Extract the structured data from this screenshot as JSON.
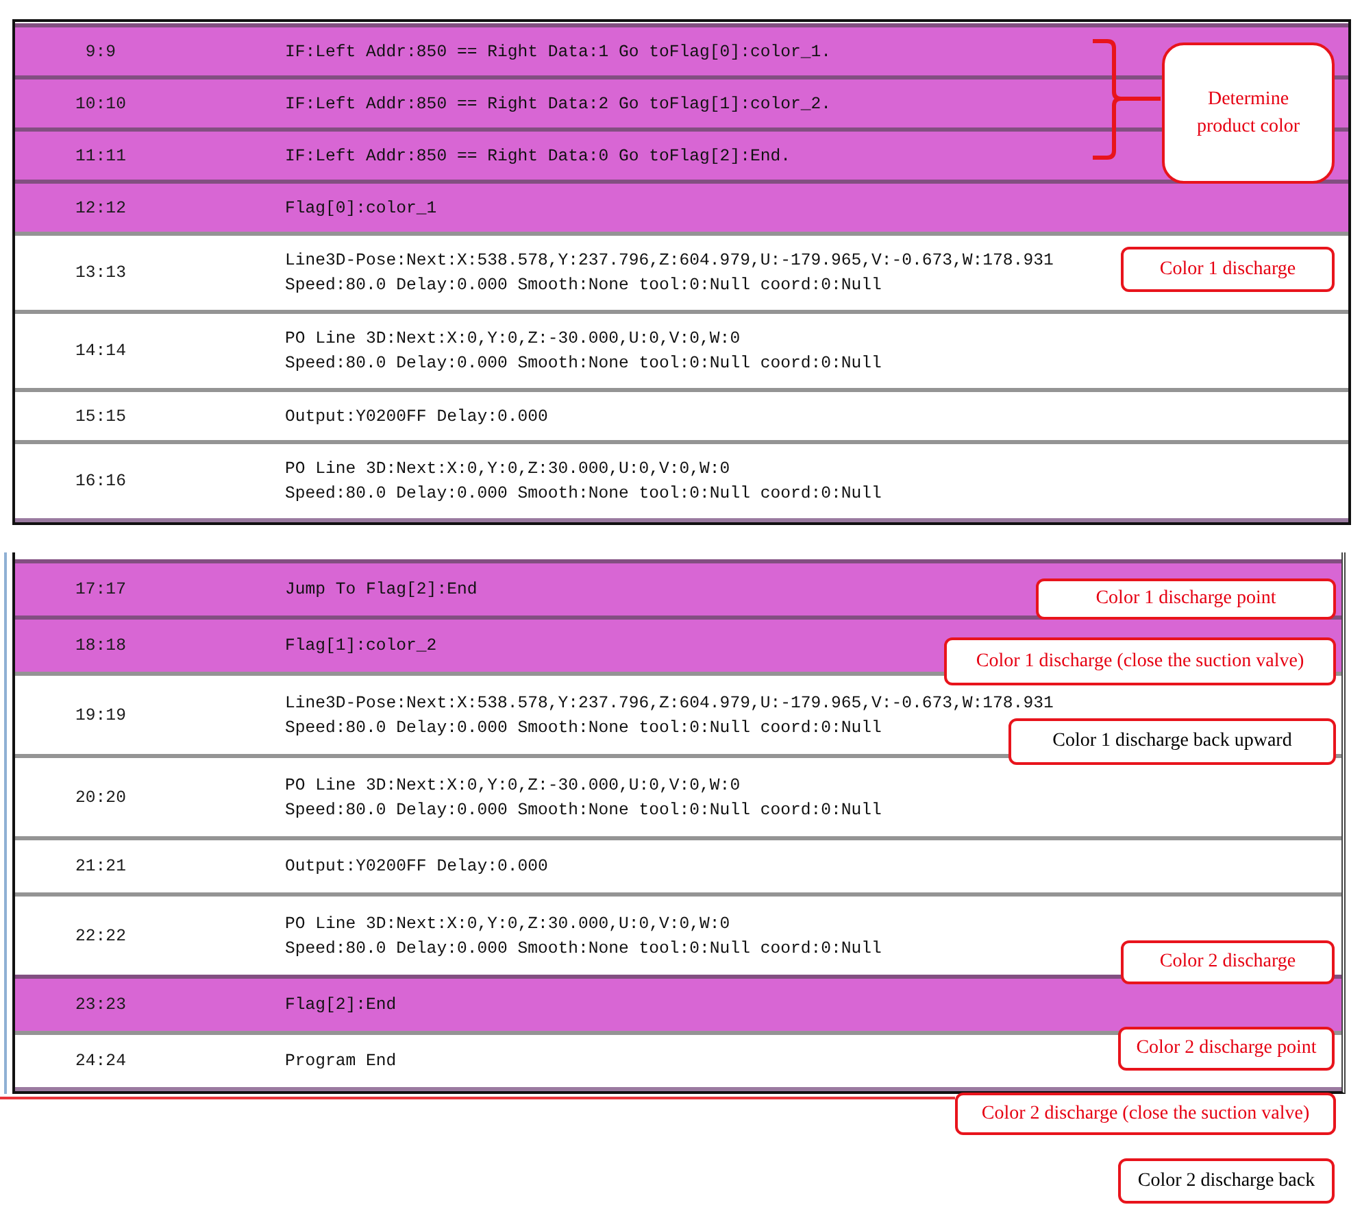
{
  "panels": [
    {
      "rows": [
        {
          "number": "9:9",
          "lines": [
            "IF:Left Addr:850 == Right Data:1 Go toFlag[0]:color_1."
          ],
          "highlighted": true
        },
        {
          "number": "10:10",
          "lines": [
            "IF:Left Addr:850 == Right Data:2 Go toFlag[1]:color_2."
          ],
          "highlighted": true
        },
        {
          "number": "11:11",
          "lines": [
            "IF:Left Addr:850 == Right Data:0 Go toFlag[2]:End."
          ],
          "highlighted": true
        },
        {
          "number": "12:12",
          "lines": [
            "Flag[0]:color_1"
          ],
          "highlighted": true
        },
        {
          "number": "13:13",
          "lines": [
            "Line3D-Pose:Next:X:538.578,Y:237.796,Z:604.979,U:-179.965,V:-0.673,W:178.931",
            "Speed:80.0 Delay:0.000 Smooth:None tool:0:Null coord:0:Null"
          ],
          "highlighted": false
        },
        {
          "number": "14:14",
          "lines": [
            "PO Line 3D:Next:X:0,Y:0,Z:-30.000,U:0,V:0,W:0",
            "Speed:80.0 Delay:0.000 Smooth:None tool:0:Null coord:0:Null"
          ],
          "highlighted": false
        },
        {
          "number": "15:15",
          "lines": [
            "Output:Y0200FF Delay:0.000"
          ],
          "highlighted": false
        },
        {
          "number": "16:16",
          "lines": [
            "PO Line 3D:Next:X:0,Y:0,Z:30.000,U:0,V:0,W:0",
            "Speed:80.0 Delay:0.000 Smooth:None tool:0:Null coord:0:Null"
          ],
          "highlighted": false
        }
      ]
    },
    {
      "rows": [
        {
          "number": "17:17",
          "lines": [
            "Jump To Flag[2]:End"
          ],
          "highlighted": true
        },
        {
          "number": "18:18",
          "lines": [
            "Flag[1]:color_2"
          ],
          "highlighted": true
        },
        {
          "number": "19:19",
          "lines": [
            "Line3D-Pose:Next:X:538.578,Y:237.796,Z:604.979,U:-179.965,V:-0.673,W:178.931",
            "Speed:80.0 Delay:0.000 Smooth:None tool:0:Null coord:0:Null"
          ],
          "highlighted": false
        },
        {
          "number": "20:20",
          "lines": [
            "PO Line 3D:Next:X:0,Y:0,Z:-30.000,U:0,V:0,W:0",
            "Speed:80.0 Delay:0.000 Smooth:None tool:0:Null coord:0:Null"
          ],
          "highlighted": false
        },
        {
          "number": "21:21",
          "lines": [
            "Output:Y0200FF Delay:0.000"
          ],
          "highlighted": false
        },
        {
          "number": "22:22",
          "lines": [
            "PO Line 3D:Next:X:0,Y:0,Z:30.000,U:0,V:0,W:0",
            "Speed:80.0 Delay:0.000 Smooth:None tool:0:Null coord:0:Null"
          ],
          "highlighted": false
        },
        {
          "number": "23:23",
          "lines": [
            "Flag[2]:End"
          ],
          "highlighted": true
        },
        {
          "number": "24:24",
          "lines": [
            "Program End"
          ],
          "highlighted": false
        }
      ]
    }
  ],
  "callouts": [
    {
      "text": "Determine product color",
      "color": "#e60012"
    },
    {
      "text": "Color 1 discharge",
      "color": "#e60012"
    },
    {
      "text": "Color 1 discharge point",
      "color": "#e60012"
    },
    {
      "text": "Color 1 discharge (close the suction valve)",
      "color": "#e60012"
    },
    {
      "text": "Color 1 discharge back upward",
      "color": "#000000"
    },
    {
      "text": "Color 2 discharge",
      "color": "#e60012"
    },
    {
      "text": "Color 2 discharge point",
      "color": "#e60012"
    },
    {
      "text": "Color 2 discharge (close the suction valve)",
      "color": "#e60012"
    },
    {
      "text": "Color 2 discharge back",
      "color": "#000000"
    }
  ]
}
